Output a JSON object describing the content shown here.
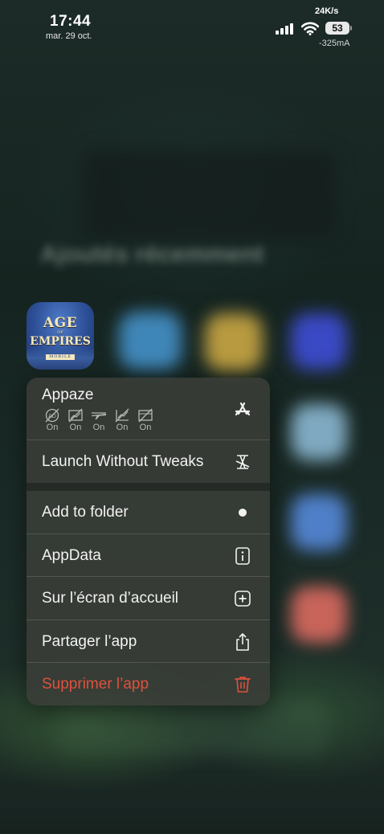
{
  "status_bar": {
    "time": "17:44",
    "date": "mar. 29 oct.",
    "network_speed": "24K/s",
    "battery_level": "53",
    "current": "-325mA"
  },
  "home": {
    "blurred_widget_text": "Ajoutés récemment"
  },
  "app": {
    "icon_title_line1": "AGE",
    "icon_title_line2": "OF",
    "icon_title_line3": "EMPIRES",
    "icon_title_line4": "MOBILE"
  },
  "menu": {
    "appaze": {
      "title": "Appaze",
      "icon": "app-store-icon",
      "toggles": [
        {
          "icon": "ads-off-icon",
          "state": "On"
        },
        {
          "icon": "image-off-icon",
          "state": "On"
        },
        {
          "icon": "airplane-off-icon",
          "state": "On"
        },
        {
          "icon": "chart-off-icon",
          "state": "On"
        },
        {
          "icon": "layers-off-icon",
          "state": "On"
        }
      ]
    },
    "launch_without_tweaks": {
      "label": "Launch Without Tweaks",
      "icon": "tweaks-off-icon"
    },
    "add_to_folder": {
      "label": "Add to folder",
      "icon": "dot-icon"
    },
    "appdata": {
      "label": "AppData",
      "icon": "info-icon"
    },
    "home_screen": {
      "label": "Sur l’écran d’accueil",
      "icon": "plus-square-icon"
    },
    "share": {
      "label": "Partager l’app",
      "icon": "share-icon"
    },
    "delete": {
      "label": "Supprimer l’app",
      "icon": "trash-icon",
      "color": "#e0503d"
    }
  }
}
